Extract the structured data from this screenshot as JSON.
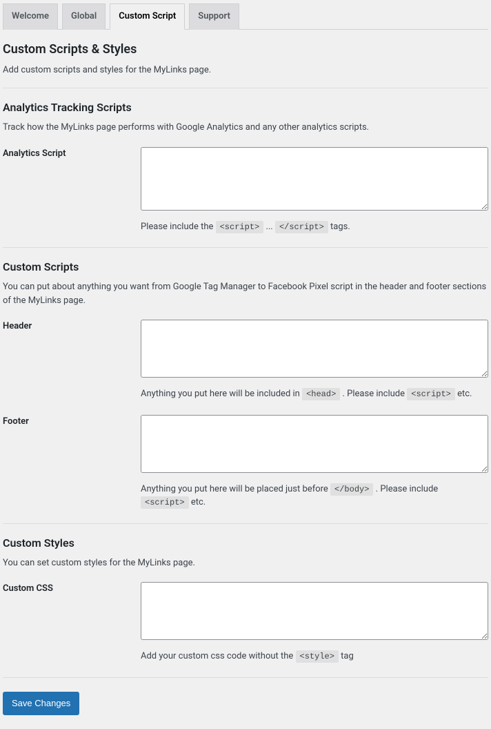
{
  "tabs": [
    {
      "label": "Welcome",
      "active": false
    },
    {
      "label": "Global",
      "active": false
    },
    {
      "label": "Custom Script",
      "active": true
    },
    {
      "label": "Support",
      "active": false
    }
  ],
  "main": {
    "title": "Custom Scripts & Styles",
    "desc": "Add custom scripts and styles for the MyLinks page."
  },
  "analytics": {
    "heading": "Analytics Tracking Scripts",
    "help": "Track how the MyLinks page performs with Google Analytics and any other analytics scripts.",
    "field_label": "Analytics Script",
    "value": "",
    "hint_prefix": "Please include the ",
    "hint_code1": "<script>",
    "hint_mid": " ... ",
    "hint_code2": "</script>",
    "hint_suffix": " tags."
  },
  "custom_scripts": {
    "heading": "Custom Scripts",
    "help": "You can put about anything you want from Google Tag Manager to Facebook Pixel script in the header and footer sections of the MyLinks page.",
    "header": {
      "label": "Header",
      "value": "",
      "hint_prefix": "Anything you put here will be included in ",
      "hint_code1": "<head>",
      "hint_mid": " . Please include ",
      "hint_code2": "<script>",
      "hint_suffix": " etc."
    },
    "footer": {
      "label": "Footer",
      "value": "",
      "hint_prefix": "Anything you put here will be placed just before ",
      "hint_code1": "</body>",
      "hint_mid": " . Please include ",
      "hint_code2": "<script>",
      "hint_suffix": " etc."
    }
  },
  "custom_styles": {
    "heading": "Custom Styles",
    "help": "You can set custom styles for the MyLinks page.",
    "css": {
      "label": "Custom CSS",
      "value": "",
      "hint_prefix": "Add your custom css code without the ",
      "hint_code1": "<style>",
      "hint_suffix": " tag"
    }
  },
  "save_button": "Save Changes"
}
